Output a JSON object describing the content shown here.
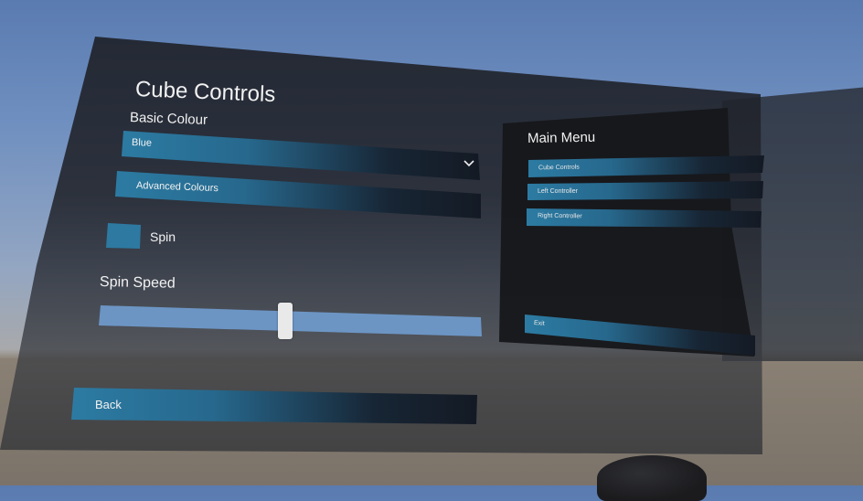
{
  "cube_controls": {
    "title": "Cube Controls",
    "basic_colour_label": "Basic Colour",
    "colour_dropdown": {
      "selected": "Blue"
    },
    "advanced_colours_label": "Advanced Colours",
    "spin_label": "Spin",
    "spin_checked": false,
    "spin_speed_label": "Spin Speed",
    "spin_speed_value": 0.5,
    "back_label": "Back"
  },
  "main_menu": {
    "title": "Main Menu",
    "items": [
      {
        "label": "Cube Controls"
      },
      {
        "label": "Left Controller"
      },
      {
        "label": "Right Controller"
      }
    ],
    "exit_label": "Exit"
  },
  "colors": {
    "accent": "#2c7ba3",
    "panel": "#1e2128",
    "slider_track": "#6c95c4"
  }
}
